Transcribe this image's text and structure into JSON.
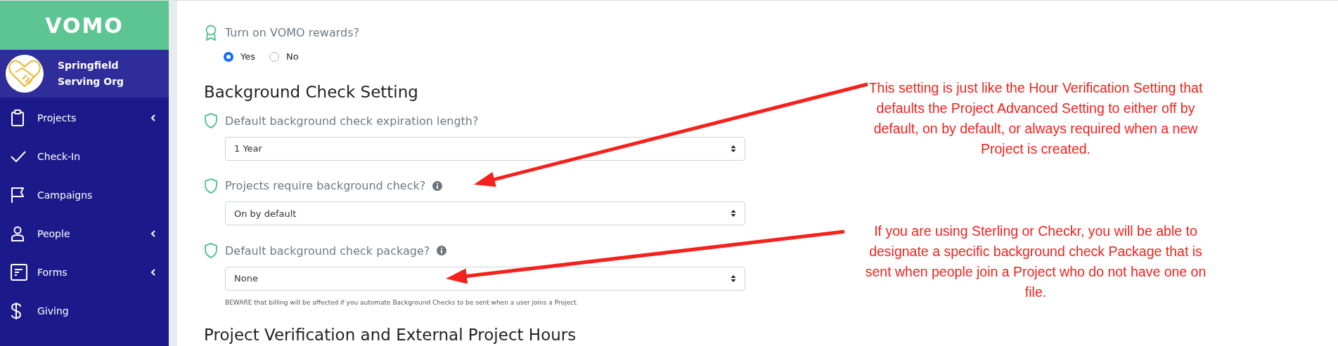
{
  "sidebar": {
    "logo": "VOMO",
    "org_name": "Springfield Serving Org",
    "items": [
      {
        "label": "Projects",
        "expandable": true
      },
      {
        "label": "Check-In",
        "expandable": false
      },
      {
        "label": "Campaigns",
        "expandable": false
      },
      {
        "label": "People",
        "expandable": true
      },
      {
        "label": "Forms",
        "expandable": true
      },
      {
        "label": "Giving",
        "expandable": false
      }
    ]
  },
  "content": {
    "rewards": {
      "label": "Turn on VOMO rewards?",
      "options": [
        {
          "label": "Yes",
          "selected": true
        },
        {
          "label": "No",
          "selected": false
        }
      ]
    },
    "section_title": "Background Check Setting",
    "settings": [
      {
        "label": "Default background check expiration length?",
        "info": false,
        "value": "1 Year"
      },
      {
        "label": "Projects require background check?",
        "info": true,
        "value": "On by default"
      },
      {
        "label": "Default background check package?",
        "info": true,
        "value": "None",
        "help": "BEWARE that billing will be affected if you automate Background Checks to be sent when a user joins a Project."
      }
    ],
    "next_section_title": "Project Verification and External Project Hours"
  },
  "annotations": [
    {
      "text": "This setting is just like the Hour Verification Setting that defaults the Project Advanced Setting to either off by default, on by default, or always required when a new Project is created."
    },
    {
      "text": "If you are using Sterling or Checkr, you will be able to designate a specific background check Package that is sent when people join a Project who do not have one on file."
    }
  ]
}
